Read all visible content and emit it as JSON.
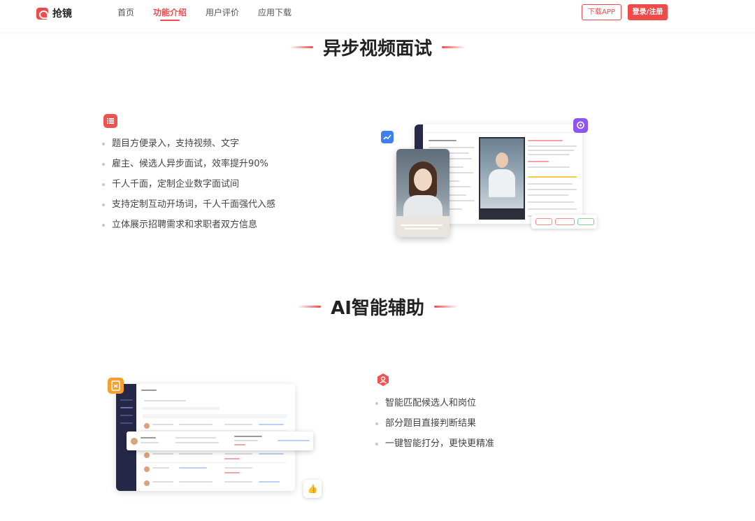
{
  "header": {
    "logo_text": "抢镜",
    "nav": [
      {
        "label": "首页",
        "active": false
      },
      {
        "label": "功能介绍",
        "active": true
      },
      {
        "label": "用户评价",
        "active": false
      },
      {
        "label": "应用下载",
        "active": false
      }
    ],
    "download_label": "下载APP",
    "login_label": "登录/注册"
  },
  "section1": {
    "title": "异步视频面试",
    "features": [
      "题目方便录入，支持视频、文字",
      "雇主、候选人异步面试，效率提升90%",
      "千人千面，定制企业数字面试间",
      "支持定制互动开场词，千人千面强代入感",
      "立体展示招聘需求和求职者双方信息"
    ],
    "icon": "list-icon"
  },
  "section2": {
    "title": "AI智能辅助",
    "features": [
      "智能匹配候选人和岗位",
      "部分题目直接判断结果",
      "一键智能打分，更快更精准"
    ],
    "icon": "user-shield-icon"
  },
  "colors": {
    "brand": "#ef4b4b",
    "badge_blue": "#3f7ff1",
    "badge_purple": "#8e54f4",
    "badge_orange": "#fb9e2e"
  }
}
